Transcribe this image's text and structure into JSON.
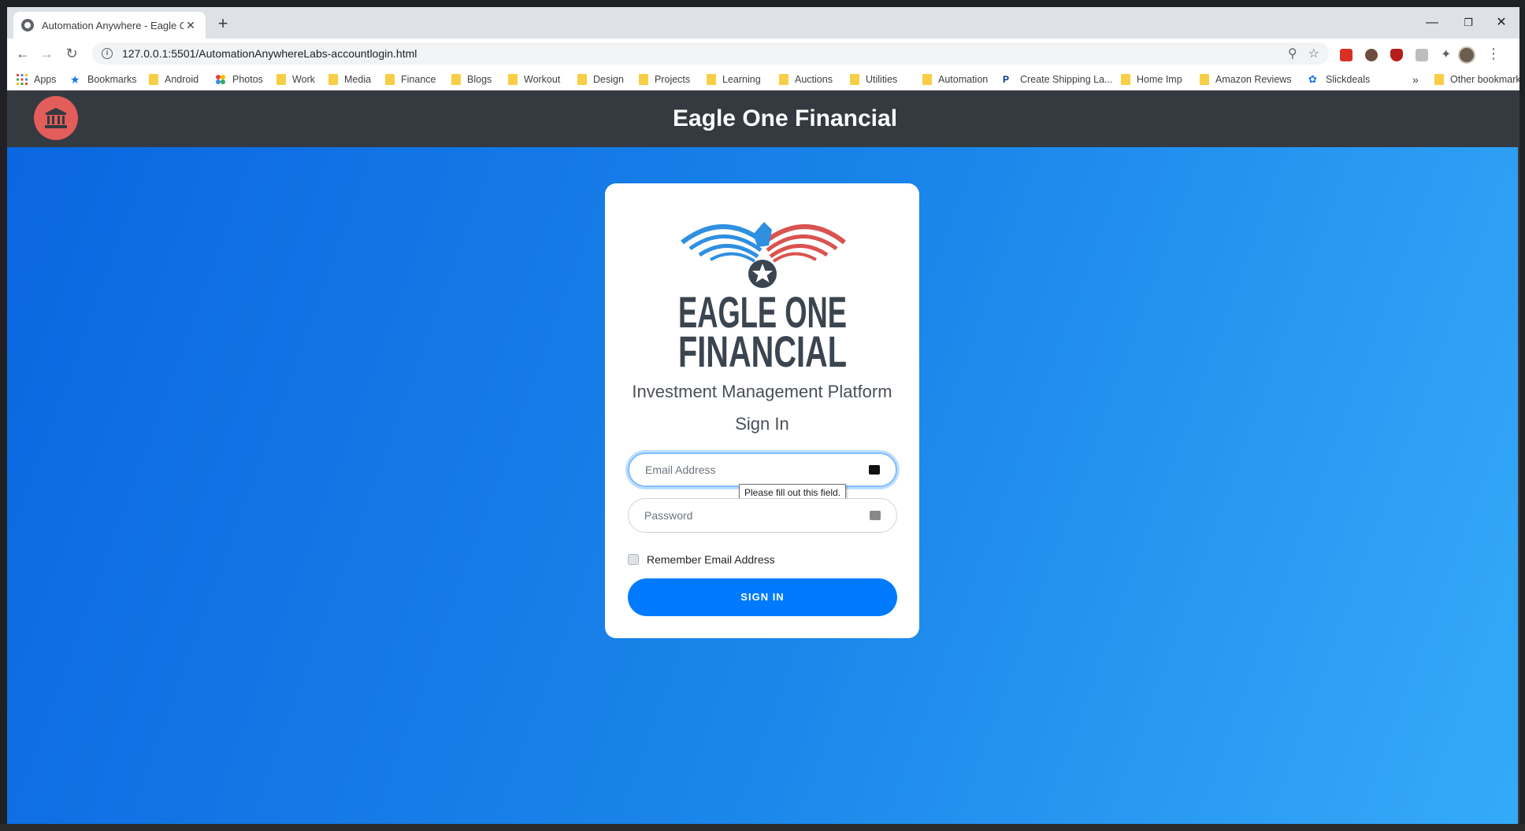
{
  "browser": {
    "tab_title": "Automation Anywhere - Eagle One Financial",
    "url": "127.0.0.1:5501/AutomationAnywhereLabs-accountlogin.html",
    "bookmarks": [
      {
        "label": "Apps",
        "icon": "apps-grid-icon"
      },
      {
        "label": "Bookmarks",
        "icon": "star-icon"
      },
      {
        "label": "Android",
        "icon": "folder-icon"
      },
      {
        "label": "Photos",
        "icon": "photos-icon"
      },
      {
        "label": "Work",
        "icon": "folder-icon"
      },
      {
        "label": "Media",
        "icon": "folder-icon"
      },
      {
        "label": "Finance",
        "icon": "folder-icon"
      },
      {
        "label": "Blogs",
        "icon": "folder-icon"
      },
      {
        "label": "Workout",
        "icon": "folder-icon"
      },
      {
        "label": "Design",
        "icon": "folder-icon"
      },
      {
        "label": "Projects",
        "icon": "folder-icon"
      },
      {
        "label": "Learning",
        "icon": "folder-icon"
      },
      {
        "label": "Auctions",
        "icon": "folder-icon"
      },
      {
        "label": "Utilities",
        "icon": "folder-icon"
      },
      {
        "label": "Automation",
        "icon": "folder-icon"
      },
      {
        "label": "Create Shipping La...",
        "icon": "paypal-icon"
      },
      {
        "label": "Home Imp",
        "icon": "folder-icon"
      },
      {
        "label": "Amazon Reviews",
        "icon": "folder-icon"
      },
      {
        "label": "Slickdeals",
        "icon": "slickdeals-icon"
      }
    ],
    "overflow": "»",
    "other_bookmarks": "Other bookmarks"
  },
  "app": {
    "title": "Eagle One Financial",
    "logo_line1": "EAGLE ONE",
    "logo_line2": "FINANCIAL",
    "platform": "Investment Management Platform",
    "heading": "Sign In",
    "email_placeholder": "Email Address",
    "password_placeholder": "Password",
    "tooltip": "Please fill out this field.",
    "remember_label": "Remember Email Address",
    "signin_button": "SIGN IN"
  },
  "colors": {
    "appbar": "#343a40",
    "bank_badge": "#e35d5b",
    "primary": "#007bff",
    "logo_blue": "#2f8fe0",
    "logo_red": "#d9534f",
    "logo_text": "#3a4550"
  }
}
